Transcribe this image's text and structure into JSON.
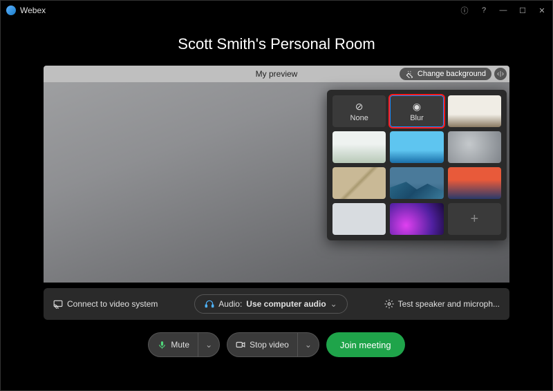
{
  "app": {
    "name": "Webex"
  },
  "room": {
    "title": "Scott Smith's Personal Room"
  },
  "preview": {
    "label": "My preview",
    "change_bg": "Change background"
  },
  "backgrounds": {
    "none": "None",
    "blur": "Blur"
  },
  "bottom": {
    "connect_video": "Connect to video system",
    "audio_label": "Audio:",
    "audio_value": "Use computer audio",
    "test_speaker": "Test speaker and microph..."
  },
  "controls": {
    "mute": "Mute",
    "stop_video": "Stop video",
    "join": "Join meeting"
  }
}
